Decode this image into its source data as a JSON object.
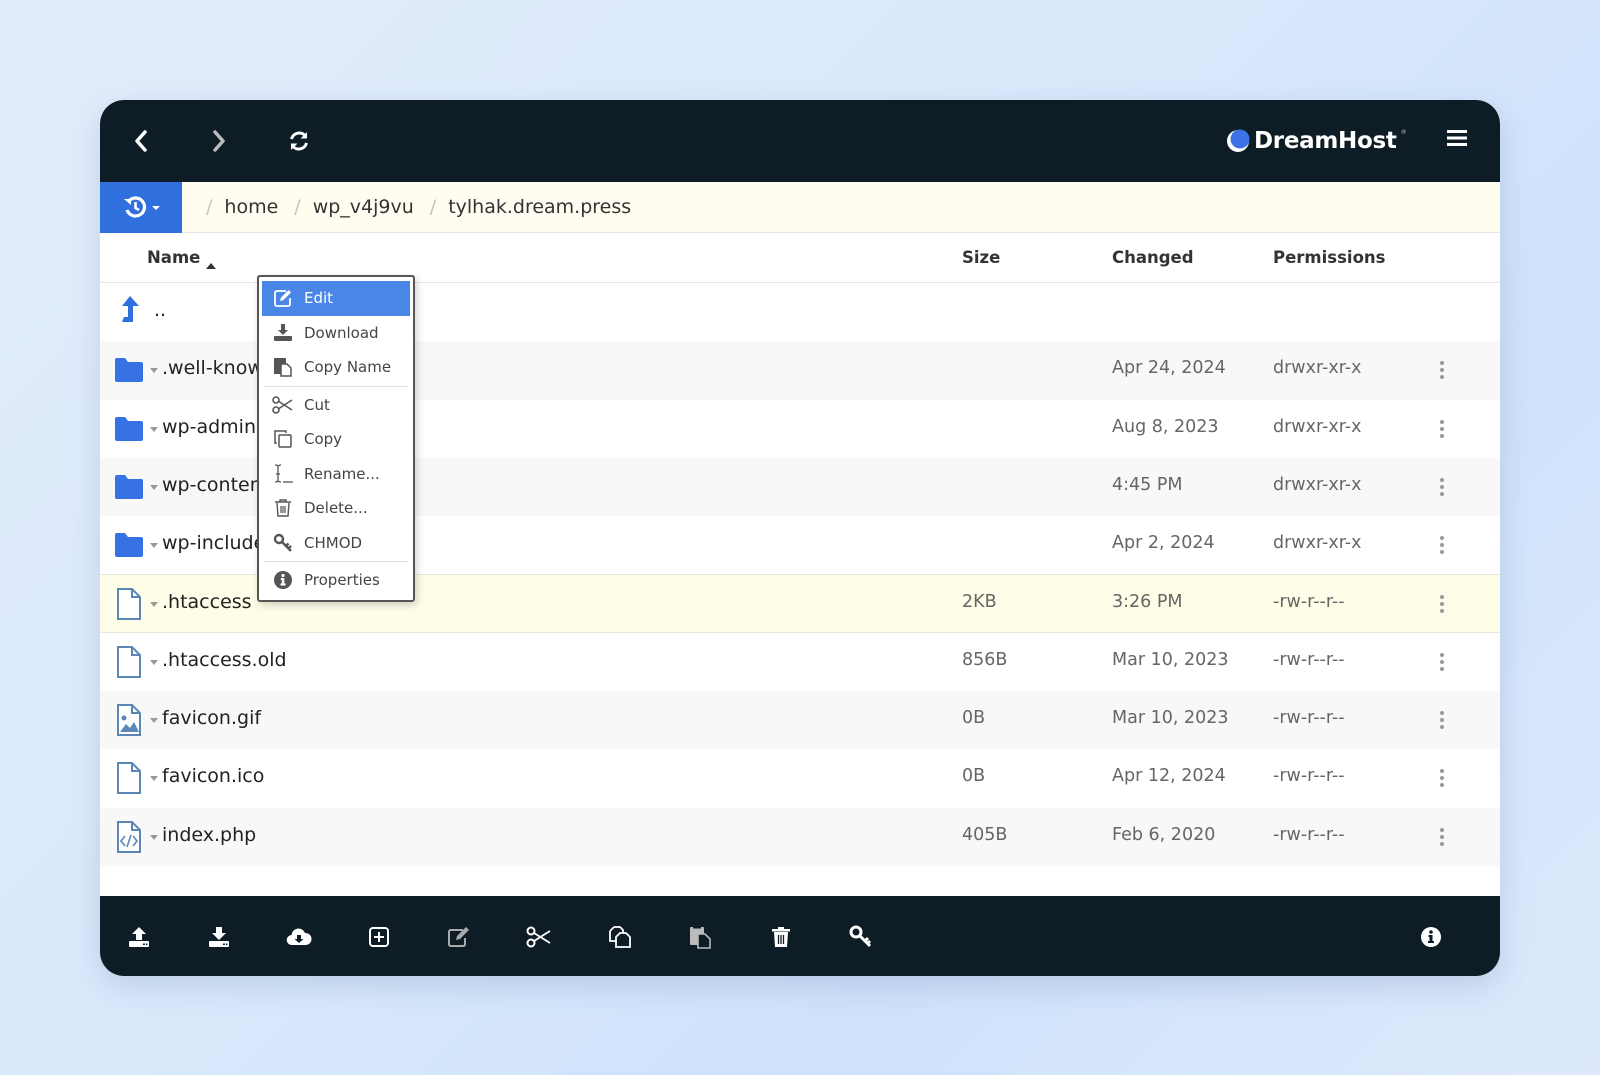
{
  "brand": {
    "name": "DreamHost",
    "accent": "#2f6fde",
    "dark": "#0e1c25"
  },
  "topbar": {
    "back_icon": "chevron-left-icon",
    "forward_icon": "chevron-right-icon",
    "refresh_icon": "refresh-icon",
    "menu_icon": "hamburger-menu-icon",
    "logo_text": "DreamHost",
    "logo_tm": "®"
  },
  "breadcrumb": {
    "history_icon": "history-icon",
    "separator": "/",
    "items": [
      "home",
      "wp_v4j9vu",
      "tylhak.dream.press"
    ]
  },
  "table": {
    "columns": {
      "name": "Name",
      "size": "Size",
      "changed": "Changed",
      "permissions": "Permissions"
    },
    "sort": {
      "column": "Name",
      "direction": "ascending"
    },
    "parent_row": {
      "name": "..",
      "icon": "level-up-icon"
    },
    "rows": [
      {
        "name": ".well-known",
        "type": "folder",
        "size": "",
        "changed": "Apr 24, 2024",
        "permissions": "drwxr-xr-x"
      },
      {
        "name": "wp-admin",
        "type": "folder",
        "size": "",
        "changed": "Aug 8, 2023",
        "permissions": "drwxr-xr-x"
      },
      {
        "name": "wp-content",
        "type": "folder",
        "size": "",
        "changed": "4:45 PM",
        "permissions": "drwxr-xr-x"
      },
      {
        "name": "wp-includes",
        "type": "folder",
        "size": "",
        "changed": "Apr 2, 2024",
        "permissions": "drwxr-xr-x"
      },
      {
        "name": ".htaccess",
        "type": "file",
        "size": "2KB",
        "changed": "3:26 PM",
        "permissions": "-rw-r--r--",
        "selected": true
      },
      {
        "name": ".htaccess.old",
        "type": "file",
        "size": "856B",
        "changed": "Mar 10, 2023",
        "permissions": "-rw-r--r--"
      },
      {
        "name": "favicon.gif",
        "type": "image",
        "size": "0B",
        "changed": "Mar 10, 2023",
        "permissions": "-rw-r--r--"
      },
      {
        "name": "favicon.ico",
        "type": "file",
        "size": "0B",
        "changed": "Apr 12, 2024",
        "permissions": "-rw-r--r--"
      },
      {
        "name": "index.php",
        "type": "code",
        "size": "405B",
        "changed": "Feb 6, 2020",
        "permissions": "-rw-r--r--"
      }
    ]
  },
  "context_menu": {
    "items": [
      {
        "label": "Edit",
        "icon": "edit-icon",
        "active": true
      },
      {
        "label": "Download",
        "icon": "download-icon"
      },
      {
        "label": "Copy Name",
        "icon": "copy-name-icon"
      },
      {
        "label": "Cut",
        "icon": "scissors-icon"
      },
      {
        "label": "Copy",
        "icon": "copy-icon"
      },
      {
        "label": "Rename...",
        "icon": "rename-cursor-icon"
      },
      {
        "label": "Delete...",
        "icon": "trash-icon"
      },
      {
        "label": "CHMOD",
        "icon": "key-icon"
      },
      {
        "label": "Properties",
        "icon": "info-icon"
      }
    ]
  },
  "bottom_toolbar": {
    "buttons": [
      {
        "name": "upload",
        "icon": "upload-icon"
      },
      {
        "name": "download",
        "icon": "download-icon"
      },
      {
        "name": "cloud-download",
        "icon": "cloud-download-icon"
      },
      {
        "name": "new",
        "icon": "plus-square-icon"
      },
      {
        "name": "edit",
        "icon": "edit-icon"
      },
      {
        "name": "cut",
        "icon": "scissors-icon"
      },
      {
        "name": "copy",
        "icon": "copy-icon"
      },
      {
        "name": "paste",
        "icon": "paste-icon"
      },
      {
        "name": "delete",
        "icon": "trash-icon"
      },
      {
        "name": "chmod",
        "icon": "key-icon"
      },
      {
        "name": "info",
        "icon": "info-icon"
      }
    ]
  }
}
